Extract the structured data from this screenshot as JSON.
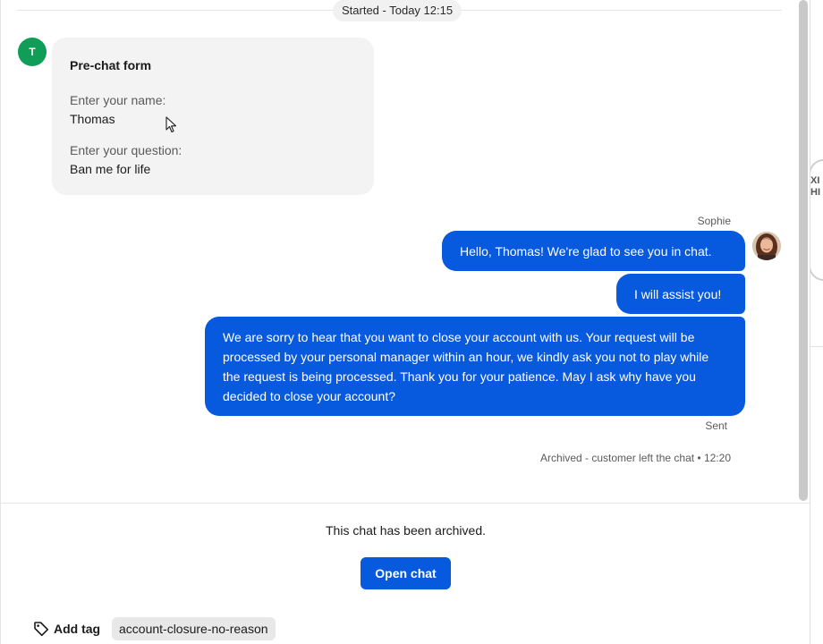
{
  "chat": {
    "started_label": "Started - Today 12:15",
    "customer_initial": "T",
    "prechat": {
      "title": "Pre-chat form",
      "name_label": "Enter your name:",
      "name_value": "Thomas",
      "question_label": "Enter your question:",
      "question_value": "Ban me for life"
    },
    "agent_name": "Sophie",
    "messages": [
      "Hello, Thomas! We're glad to see you in chat.",
      "I will assist you!",
      "We are sorry to hear that you want to close your account with us. Your request will be processed by your personal manager within an hour, we kindly ask you not to play while the request is being processed. Thank you for your patience. May I ask why have you decided to close your account?"
    ],
    "sent_status": "Sent",
    "archived_meta": "Archived - customer left the chat • 12:20"
  },
  "footer": {
    "archived_notice": "This chat has been archived.",
    "open_chat_label": "Open chat",
    "add_tag_label": "Add tag",
    "tags": [
      "account-closure-no-reason"
    ]
  },
  "icons": {
    "tag": "tag-icon",
    "cursor": "mouse-pointer-icon",
    "agent_avatar": "agent-avatar"
  },
  "colors": {
    "accent": "#0759dd",
    "customer_avatar": "#0f9d58",
    "card_bg": "#f3f3f3"
  }
}
